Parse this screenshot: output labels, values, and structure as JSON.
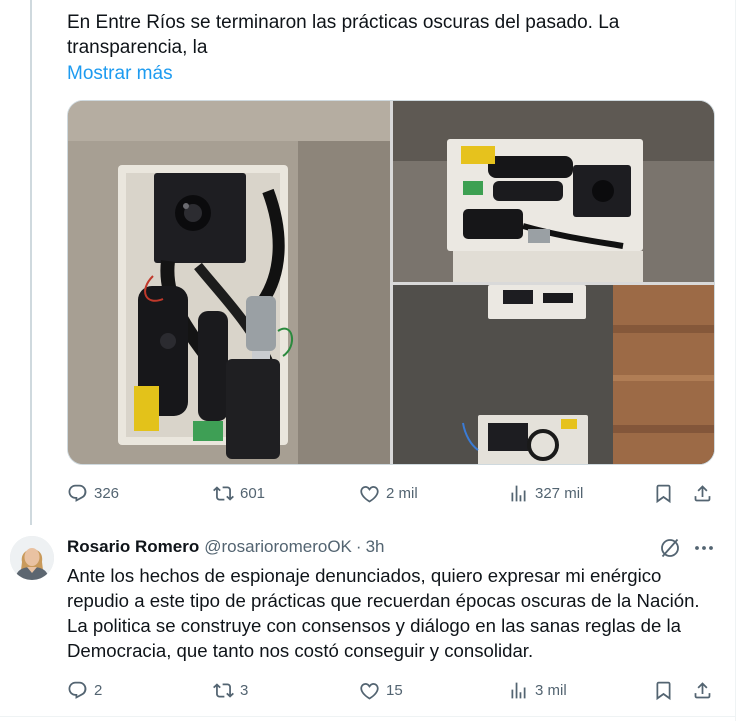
{
  "tweet1": {
    "text": "En Entre Ríos se terminaron las prácticas oscuras del pasado. La transparencia, la",
    "show_more": "Mostrar más",
    "actions": {
      "replies": "326",
      "reposts": "601",
      "likes": "2 mil",
      "views": "327 mil"
    }
  },
  "tweet2": {
    "name": "Rosario Romero",
    "handle": "@rosarioromeroOK",
    "separator": "·",
    "time": "3h",
    "text": "Ante los hechos de espionaje denunciados, quiero expresar mi enérgico repudio a este tipo de prácticas que recuerdan épocas oscuras de la Nación. La politica se construye con consensos y diálogo en las sanas reglas de la Democracia, que tanto nos costó conseguir y consolidar.",
    "actions": {
      "replies": "2",
      "reposts": "3",
      "likes": "15",
      "views": "3 mil"
    }
  },
  "icons": [
    "reply-icon",
    "repost-icon",
    "like-icon",
    "views-icon",
    "bookmark-icon",
    "share-icon",
    "grok-icon",
    "more-icon"
  ],
  "colors": {
    "link": "#1d9bf0",
    "muted": "#536471",
    "text": "#0f1419"
  }
}
